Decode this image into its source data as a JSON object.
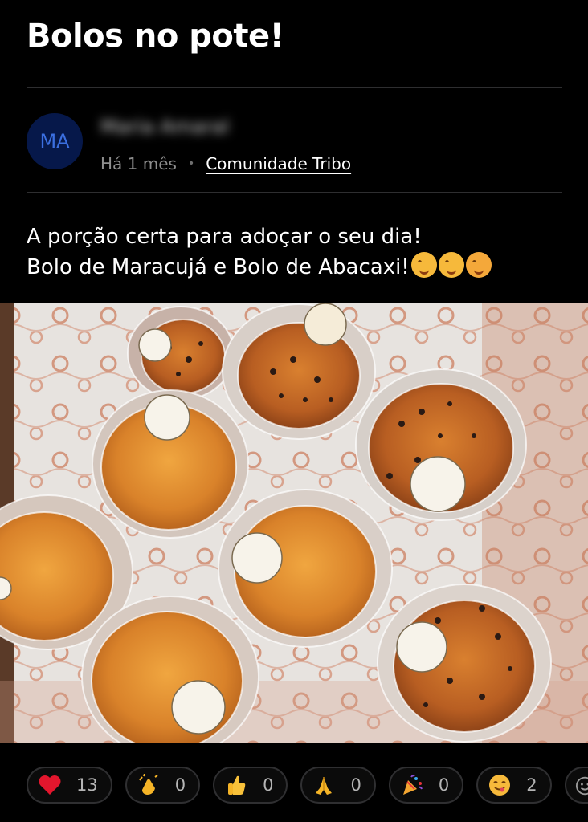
{
  "post": {
    "title": "Bolos no pote!",
    "author": {
      "initials": "MA",
      "name": "Maria Amaral"
    },
    "time_ago": "Há 1 mês",
    "separator": "•",
    "community": "Comunidade Tribo",
    "body_lines": [
      "A porção certa para adoçar o seu dia!",
      "Bolo de Maracujá e Bolo de Abacaxi!"
    ],
    "body_emojis": [
      "face-savoring-food-icon",
      "face-savoring-food-icon",
      "smiling-face-with-hearts-icon"
    ]
  },
  "reactions": [
    {
      "icon": "red-heart-icon",
      "count": "13"
    },
    {
      "icon": "clapping-hands-icon",
      "count": "0"
    },
    {
      "icon": "thumbs-up-icon",
      "count": "0"
    },
    {
      "icon": "folded-hands-icon",
      "count": "0"
    },
    {
      "icon": "party-popper-icon",
      "count": "0"
    },
    {
      "icon": "face-savoring-food-icon",
      "count": "2"
    }
  ],
  "colors": {
    "background": "#000000",
    "avatar_bg": "#06184a",
    "avatar_text": "#3b6fe0",
    "muted_text": "#8e8e8e",
    "pill_border": "#2f2f31"
  }
}
